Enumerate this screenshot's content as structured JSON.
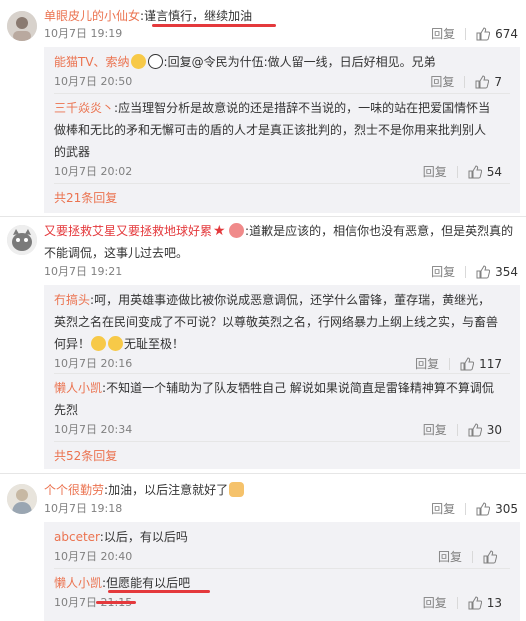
{
  "labels": {
    "reply": "回复",
    "sep": ":"
  },
  "comments": [
    {
      "user": "单眼皮儿的小仙女",
      "text": "谨言慎行，继续加油",
      "time": "10月7日 19:19",
      "likes": "674",
      "replies": [
        {
          "user": "能猫TV、索纳",
          "text": "回复@令民为什伍:做人留一线，日后好相见。兄弟",
          "time": "10月7日 20:50",
          "likes": "7"
        },
        {
          "user": "三千焱炎丶",
          "text": "应当理智分析是故意说的还是措辞不当说的，一味的站在把爱国情怀当做棒和无比的矛和无懈可击的盾的人才是真正该批判的，烈士不是你用来批判别人的武器",
          "time": "10月7日 20:02",
          "likes": "54"
        }
      ],
      "more": "共21条回复"
    },
    {
      "user": "又要拯救艾星又要拯救地球好累",
      "text": "道歉是应该的，相信你也没有恶意，但是英烈真的不能调侃，这事儿过去吧。",
      "time": "10月7日 19:21",
      "likes": "354",
      "replies": [
        {
          "user": "冇搞头",
          "text": "呵，用英雄事迹做比被你说成恶意调侃，还学什么雷锋，董存瑞，黄继光，英烈之名在民间变成了不可说？以尊敬英烈之名，行网络暴力上纲上线之实，与畜兽何异！",
          "text_tail": "无耻至极！",
          "time": "10月7日 20:16",
          "likes": "117"
        },
        {
          "user": "懒人小凯",
          "text": "不知道一个辅助为了队友牺牲自己 解说如果说简直是雷锋精神算不算调侃先烈",
          "time": "10月7日 20:34",
          "likes": "30"
        }
      ],
      "more": "共52条回复"
    },
    {
      "user": "个个很勤劳",
      "text": "加油，以后注意就好了",
      "time": "10月7日 19:18",
      "likes": "305",
      "replies": [
        {
          "user": "abceter",
          "text": "以后，有以后吗",
          "time": "10月7日 20:40",
          "likes": ""
        },
        {
          "user": "懒人小凯",
          "text": "但愿能有以后吧",
          "time": "10月7日 21:15",
          "likes": "13"
        }
      ]
    }
  ],
  "colors": {
    "username": "#eb7350",
    "underline": "#e4393c",
    "reply_bg": "#f2f2f5"
  },
  "icons": [
    "thumb-up-icon",
    "avatar-image",
    "emoji-icon"
  ]
}
